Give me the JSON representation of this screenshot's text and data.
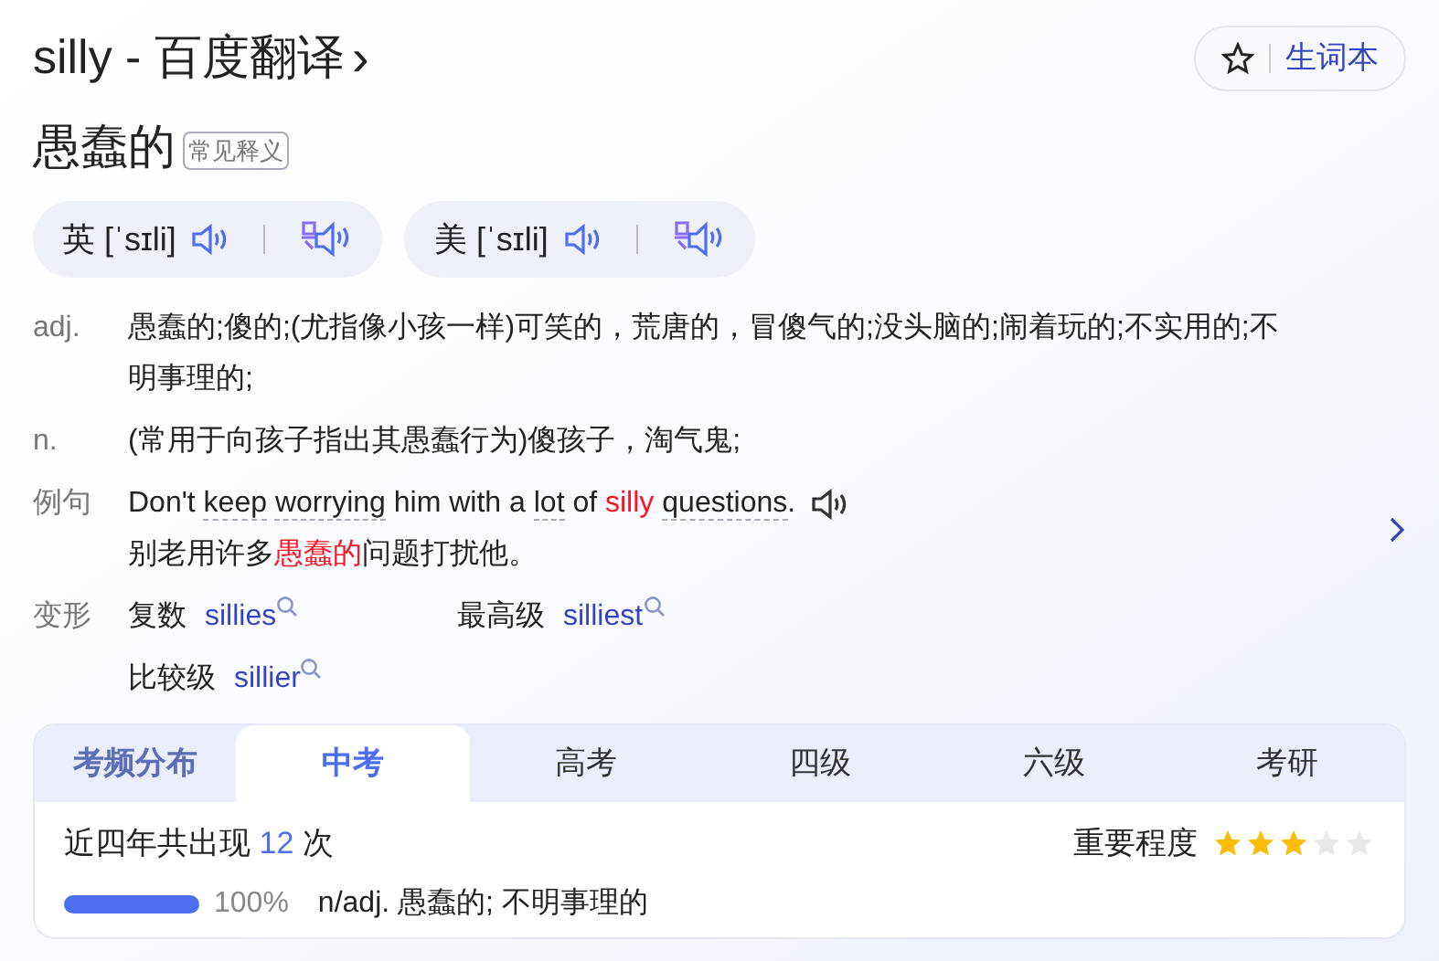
{
  "header": {
    "title": "silly - 百度翻译",
    "chevron": "›",
    "wordbook_button": "生词本"
  },
  "headword": {
    "meaning": "愚蠢的",
    "tag": "常见释义"
  },
  "pronunciations": [
    {
      "region": "英",
      "phonetic": "[ˈsɪli]"
    },
    {
      "region": "美",
      "phonetic": "[ˈsɪli]"
    }
  ],
  "definitions": [
    {
      "pos": "adj.",
      "text": "愚蠢的;傻的;(尤指像小孩一样)可笑的，荒唐的，冒傻气的;没头脑的;闹着玩的;不实用的;不明事理的;"
    },
    {
      "pos": "n.",
      "text": "(常用于向孩子指出其愚蠢行为)傻孩子，淘气鬼;"
    }
  ],
  "example": {
    "label": "例句",
    "sentence": [
      {
        "text": "Don't ",
        "kind": "plain"
      },
      {
        "text": "keep",
        "kind": "vocab",
        "space_after": true
      },
      {
        "text": "worrying",
        "kind": "vocab"
      },
      {
        "text": " him with a ",
        "kind": "plain"
      },
      {
        "text": "lot",
        "kind": "vocab"
      },
      {
        "text": " of ",
        "kind": "plain"
      },
      {
        "text": "silly",
        "kind": "highlight",
        "space_after": true
      },
      {
        "text": "questions",
        "kind": "vocab"
      },
      {
        "text": ".",
        "kind": "plain"
      }
    ],
    "translation": [
      {
        "text": "别老用许多",
        "kind": "plain"
      },
      {
        "text": "愚蠢的",
        "kind": "highlight"
      },
      {
        "text": "问题打扰他。",
        "kind": "plain"
      }
    ]
  },
  "inflections": {
    "label": "变形",
    "forms": [
      {
        "label": "复数",
        "word": "sillies"
      },
      {
        "label": "最高级",
        "word": "silliest"
      },
      {
        "label": "比较级",
        "word": "sillier"
      }
    ]
  },
  "exam_frequency": {
    "heading": "考频分布",
    "tabs": [
      {
        "label": "中考",
        "selected": true
      },
      {
        "label": "高考",
        "selected": false
      },
      {
        "label": "四级",
        "selected": false
      },
      {
        "label": "六级",
        "selected": false
      },
      {
        "label": "考研",
        "selected": false
      }
    ],
    "occurrence_prefix": "近四年共出现",
    "count": "12",
    "occurrence_suffix": "次",
    "importance_label": "重要程度",
    "stars": 3,
    "senses": [
      {
        "level": 1,
        "percent": "100%",
        "text": "n/adj. 愚蠢的; 不明事理的"
      }
    ]
  }
}
